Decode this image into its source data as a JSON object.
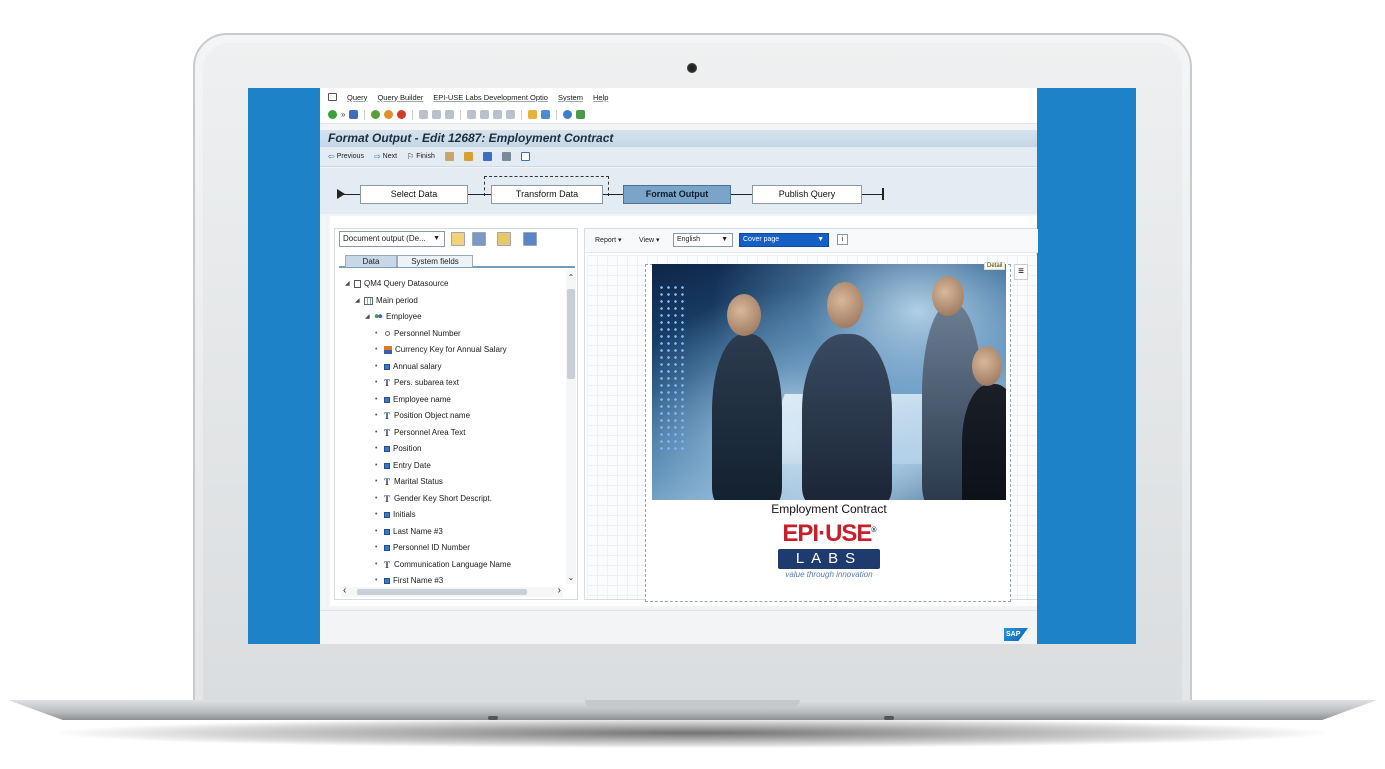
{
  "menubar": {
    "items": [
      "Query",
      "Query Builder",
      "EPI-USE Labs Development Optio",
      "System",
      "Help"
    ]
  },
  "window": {
    "title": "Format Output - Edit 12687: Employment Contract"
  },
  "appbar": {
    "previous": "Previous",
    "next": "Next",
    "finish": "Finish"
  },
  "roadmap": {
    "steps": [
      "Select Data",
      "Transform Data",
      "Format Output",
      "Publish Query"
    ],
    "active_index": 2
  },
  "left_panel": {
    "dropdown_value": "Document output (De...",
    "tabs": [
      "Data",
      "System fields"
    ],
    "tree": [
      {
        "label": "QM4 Query Datasource",
        "level": 0,
        "icon": "doc-icon"
      },
      {
        "label": "Main period",
        "level": 1,
        "icon": "grid-icon"
      },
      {
        "label": "Employee",
        "level": 2,
        "icon": "people-icon"
      },
      {
        "label": "Personnel Number",
        "level": 3,
        "icon": "key-icon"
      },
      {
        "label": "Currency Key for Annual Salary",
        "level": 3,
        "icon": "currency-icon"
      },
      {
        "label": "Annual salary",
        "level": 3,
        "icon": "field-icon"
      },
      {
        "label": "Pers. subarea text",
        "level": 3,
        "icon": "text-icon"
      },
      {
        "label": "Employee name",
        "level": 3,
        "icon": "field-icon"
      },
      {
        "label": "Position Object name",
        "level": 3,
        "icon": "text-icon"
      },
      {
        "label": "Personnel Area Text",
        "level": 3,
        "icon": "text-icon"
      },
      {
        "label": "Position",
        "level": 3,
        "icon": "field-icon"
      },
      {
        "label": "Entry Date",
        "level": 3,
        "icon": "field-icon"
      },
      {
        "label": "Marital Status",
        "level": 3,
        "icon": "text-icon"
      },
      {
        "label": "Gender Key Short Descript.",
        "level": 3,
        "icon": "text-icon"
      },
      {
        "label": "Initials",
        "level": 3,
        "icon": "field-icon"
      },
      {
        "label": "Last Name #3",
        "level": 3,
        "icon": "field-icon"
      },
      {
        "label": "Personnel ID Number",
        "level": 3,
        "icon": "field-icon"
      },
      {
        "label": "Communication Language Name",
        "level": 3,
        "icon": "text-icon"
      },
      {
        "label": "First Name #3",
        "level": 3,
        "icon": "field-icon"
      }
    ]
  },
  "right_panel": {
    "report_label": "Report",
    "view_label": "View",
    "language_value": "English",
    "page_value": "Cover page",
    "detail_tag": "Detail",
    "document": {
      "caption": "Employment Contract",
      "logo_top": "EPI·USE",
      "logo_bottom": "LABS",
      "logo_tagline": "value through innovation",
      "logo_registered": "®"
    }
  },
  "colors": {
    "screen_bg": "#1e82c8",
    "active_step": "#7ba4c9",
    "page_select": "#1560c6"
  },
  "brand": {
    "sap_logo": "SAP"
  }
}
